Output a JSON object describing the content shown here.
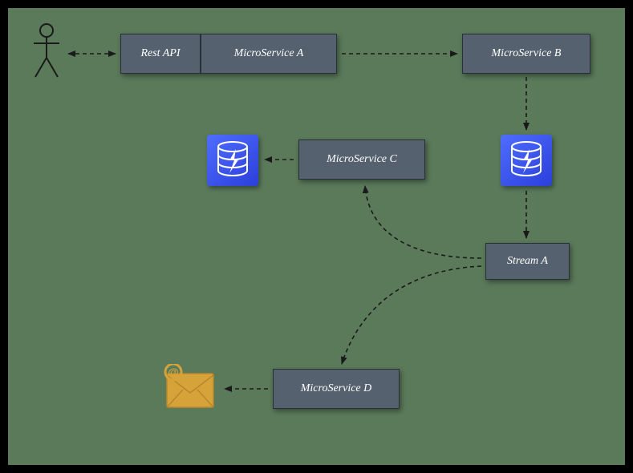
{
  "nodes": {
    "rest_api": {
      "label": "Rest API"
    },
    "service_a": {
      "label": "MicroService  A"
    },
    "service_b": {
      "label": "MicroService  B"
    },
    "service_c": {
      "label": "MicroService  C"
    },
    "service_d": {
      "label": "MicroService  D"
    },
    "stream_a": {
      "label": "Stream A"
    }
  },
  "icons": {
    "actor": "actor-icon",
    "db1": "database-bolt-icon",
    "db2": "database-bolt-icon",
    "email": "email-at-icon"
  },
  "colors": {
    "canvas_bg": "#5a7a5a",
    "canvas_border": "#000000",
    "node_fill": "#55616e",
    "node_border": "#2a2f36",
    "node_text": "#ffffff",
    "db_fill_start": "#4f6dff",
    "db_fill_end": "#2b3fd9",
    "db_stroke": "#ffffff",
    "connector": "#1a1a1a",
    "email_fill": "#d6a33a"
  }
}
